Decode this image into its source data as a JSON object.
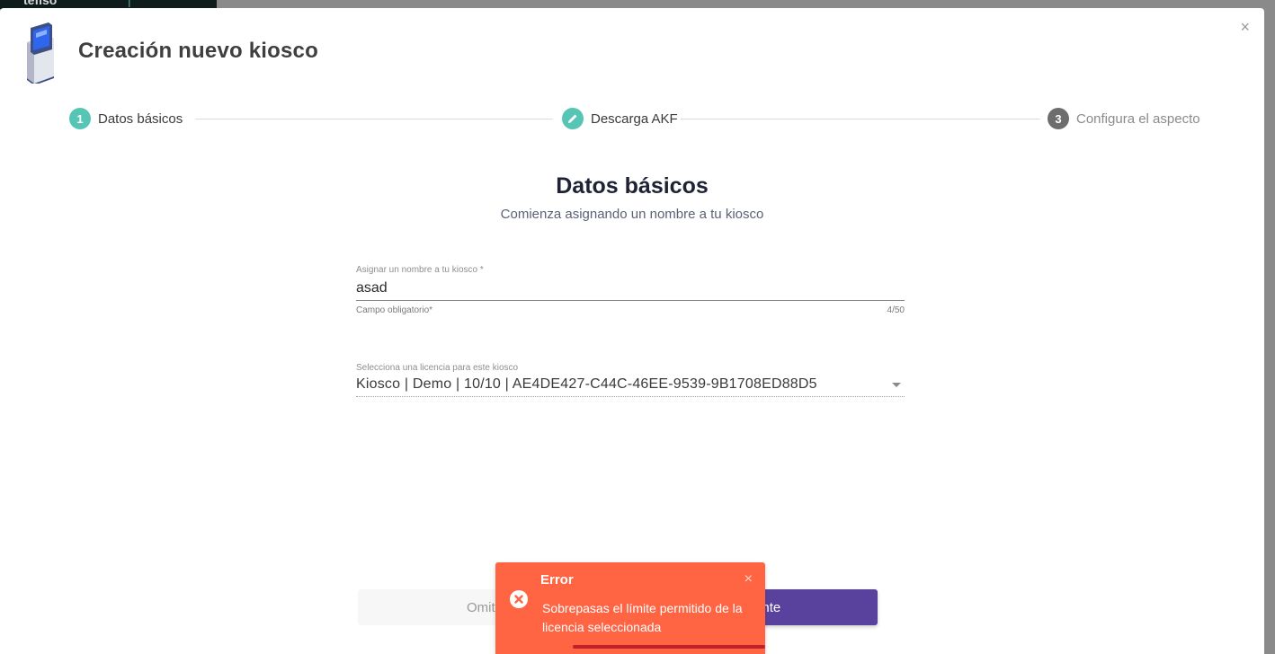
{
  "modal": {
    "title": "Creación nuevo kiosco",
    "close_glyph": "×"
  },
  "stepper": {
    "steps": [
      {
        "badge": "1",
        "label": "Datos básicos",
        "state": "active",
        "color": "#56c5b6"
      },
      {
        "badge": "",
        "label": "Descarga AKF",
        "state": "editing",
        "color": "#56c5b6",
        "icon": "pencil-icon"
      },
      {
        "badge": "3",
        "label": "Configura el aspecto",
        "state": "pending",
        "color": "#6d6d6d"
      }
    ]
  },
  "content": {
    "title": "Datos básicos",
    "subtitle": "Comienza asignando un nombre a tu kiosco"
  },
  "name_field": {
    "label": "Asignar un nombre a tu kiosco *",
    "value": "asad",
    "hint": "Campo obligatorio*",
    "counter": "4/50"
  },
  "license_field": {
    "label": "Selecciona una licencia para este kiosco",
    "selected": "Kiosco | Demo | 10/10 | AE4DE427-C44C-46EE-9539-9B1708ED88D5"
  },
  "buttons": {
    "skip": "Omitir",
    "next": "Siguiente"
  },
  "toast": {
    "title": "Error",
    "message": "Sobrepasas el límite permitido de la licencia seleccionada",
    "close_glyph": "×",
    "icon": "error-circle-icon",
    "color": "#ff6443"
  }
}
